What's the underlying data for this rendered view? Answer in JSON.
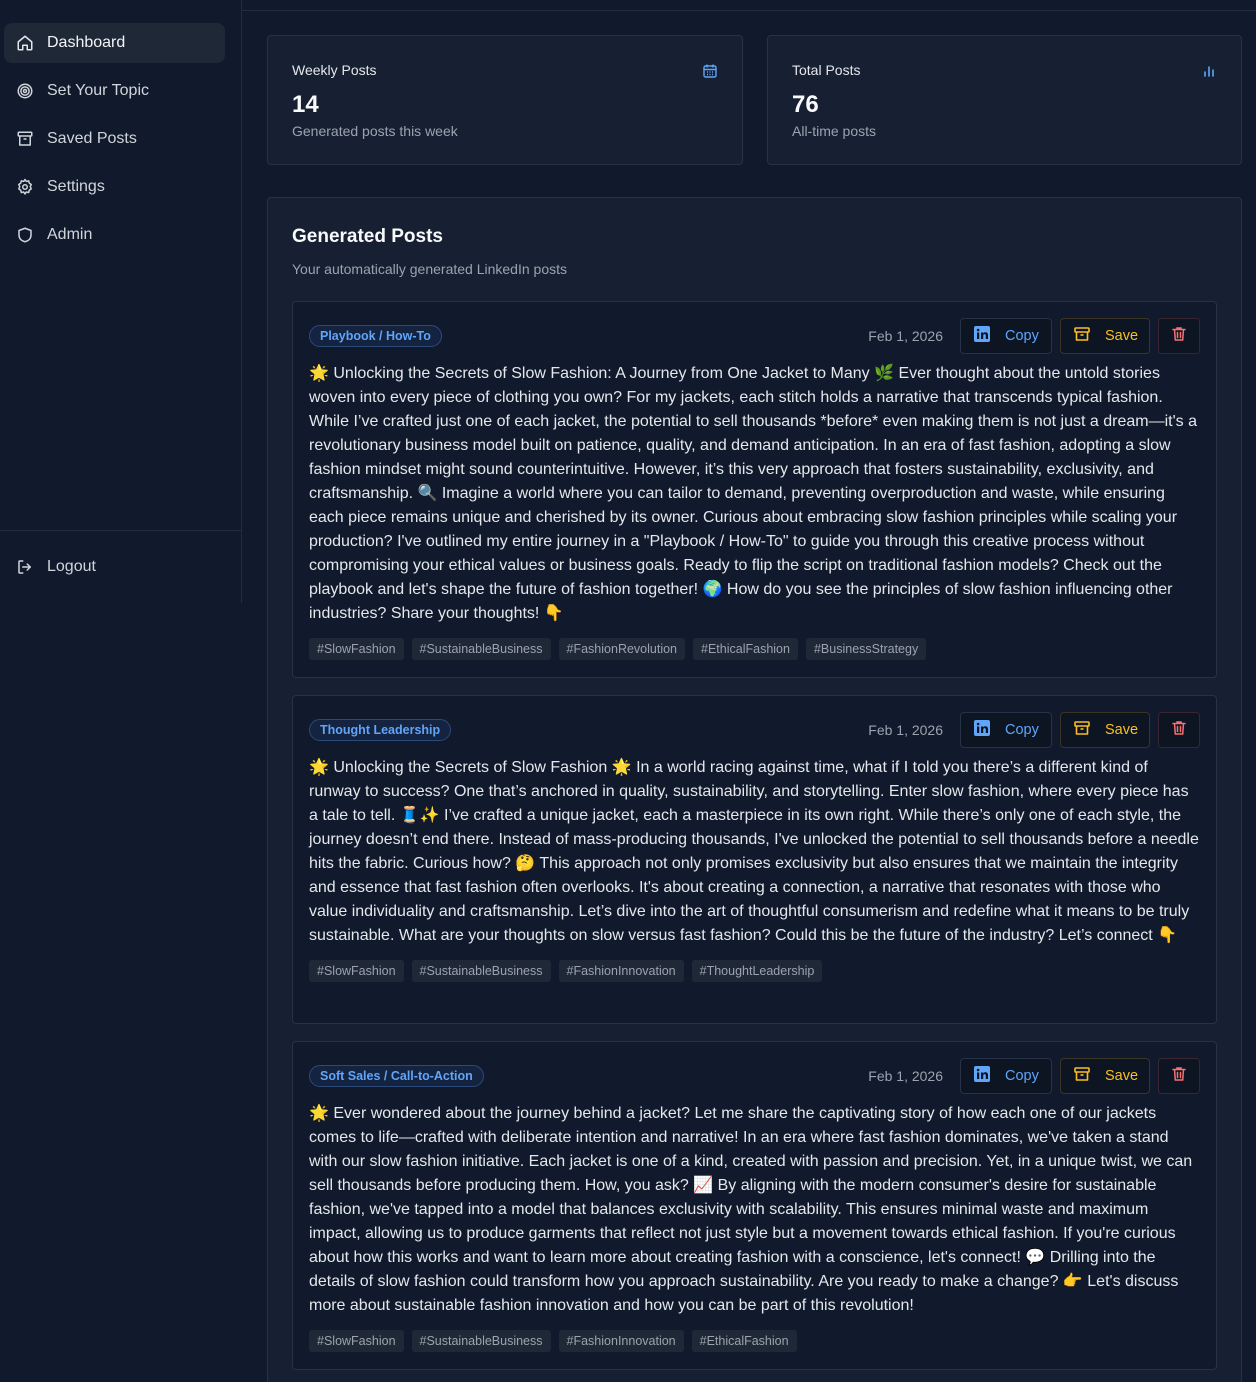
{
  "sidebar": {
    "items": [
      {
        "label": "Dashboard",
        "icon": "home-icon",
        "active": true
      },
      {
        "label": "Set Your Topic",
        "icon": "target-icon"
      },
      {
        "label": "Saved Posts",
        "icon": "archive-icon"
      },
      {
        "label": "Settings",
        "icon": "gear-icon"
      },
      {
        "label": "Admin",
        "icon": "shield-icon"
      }
    ],
    "logout_label": "Logout"
  },
  "stats": [
    {
      "label": "Weekly Posts",
      "value": "14",
      "sub": "Generated posts this week",
      "icon": "calendar-icon"
    },
    {
      "label": "Total Posts",
      "value": "76",
      "sub": "All-time posts",
      "icon": "bar-chart-icon"
    }
  ],
  "panel": {
    "title": "Generated Posts",
    "subtitle": "Your automatically generated LinkedIn posts"
  },
  "buttons": {
    "copy": "Copy",
    "save": "Save"
  },
  "colors": {
    "accent": "#60a5fa",
    "save": "#fbbf24",
    "delete": "#f87171",
    "bg": "#111a2c"
  },
  "posts": [
    {
      "badge": "Playbook / How-To",
      "date": "Feb 1, 2026",
      "body": "🌟 Unlocking the Secrets of Slow Fashion: A Journey from One Jacket to Many 🌿 Ever thought about the untold stories woven into every piece of clothing you own? For my jackets, each stitch holds a narrative that transcends typical fashion. While I’ve crafted just one of each jacket, the potential to sell thousands *before* even making them is not just a dream—it's a revolutionary business model built on patience, quality, and demand anticipation. In an era of fast fashion, adopting a slow fashion mindset might sound counterintuitive. However, it’s this very approach that fosters sustainability, exclusivity, and craftsmanship. 🔍 Imagine a world where you can tailor to demand, preventing overproduction and waste, while ensuring each piece remains unique and cherished by its owner. Curious about embracing slow fashion principles while scaling your production? I've outlined my entire journey in a \"Playbook / How-To\" to guide you through this creative process without compromising your ethical values or business goals. Ready to flip the script on traditional fashion models? Check out the playbook and let's shape the future of fashion together! 🌍 How do you see the principles of slow fashion influencing other industries? Share your thoughts! 👇",
      "tags": [
        "#SlowFashion",
        "#SustainableBusiness",
        "#FashionRevolution",
        "#EthicalFashion",
        "#BusinessStrategy"
      ]
    },
    {
      "badge": "Thought Leadership",
      "date": "Feb 1, 2026",
      "body": "🌟 Unlocking the Secrets of Slow Fashion 🌟 In a world racing against time, what if I told you there’s a different kind of runway to success? One that’s anchored in quality, sustainability, and storytelling. Enter slow fashion, where every piece has a tale to tell. 🧵✨ I’ve crafted a unique jacket, each a masterpiece in its own right. While there’s only one of each style, the journey doesn’t end there. Instead of mass-producing thousands, I've unlocked the potential to sell thousands before a needle hits the fabric. Curious how? 🤔 This approach not only promises exclusivity but also ensures that we maintain the integrity and essence that fast fashion often overlooks. It's about creating a connection, a narrative that resonates with those who value individuality and craftsmanship. Let’s dive into the art of thoughtful consumerism and redefine what it means to be truly sustainable. What are your thoughts on slow versus fast fashion? Could this be the future of the industry? Let’s connect 👇",
      "tags": [
        "#SlowFashion",
        "#SustainableBusiness",
        "#FashionInnovation",
        "#ThoughtLeadership"
      ]
    },
    {
      "badge": "Soft Sales / Call-to-Action",
      "date": "Feb 1, 2026",
      "body": "🌟 Ever wondered about the journey behind a jacket? Let me share the captivating story of how each one of our jackets comes to life—crafted with deliberate intention and narrative! In an era where fast fashion dominates, we've taken a stand with our slow fashion initiative. Each jacket is one of a kind, created with passion and precision. Yet, in a unique twist, we can sell thousands before producing them. How, you ask? 📈 By aligning with the modern consumer's desire for sustainable fashion, we've tapped into a model that balances exclusivity with scalability. This ensures minimal waste and maximum impact, allowing us to produce garments that reflect not just style but a movement towards ethical fashion. If you're curious about how this works and want to learn more about creating fashion with a conscience, let's connect! 💬 Drilling into the details of slow fashion could transform how you approach sustainability. Are you ready to make a change? 👉 Let's discuss more about sustainable fashion innovation and how you can be part of this revolution!",
      "tags": [
        "#SlowFashion",
        "#SustainableBusiness",
        "#FashionInnovation",
        "#EthicalFashion"
      ]
    }
  ]
}
